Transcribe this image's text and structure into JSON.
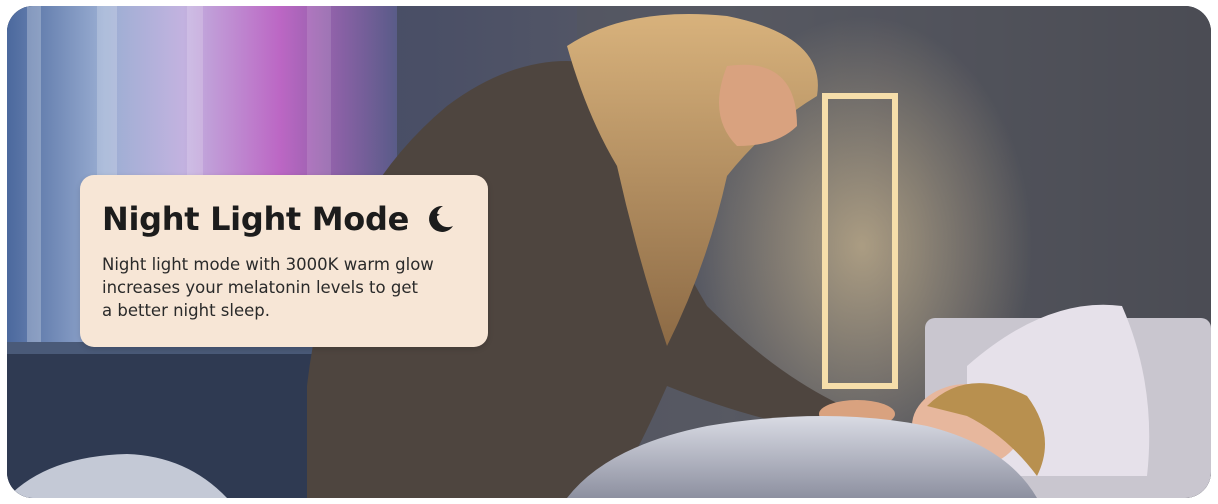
{
  "card": {
    "title": "Night Light Mode",
    "title_icon": "moon-stars-icon",
    "description_lines": [
      "Night light mode with 3000K warm glow",
      "increases your melatonin levels to get",
      "a better night sleep."
    ]
  },
  "colors": {
    "card_background": "#f7e6d6",
    "title_text": "#1c1c1c",
    "body_text": "#2a2a2a",
    "lamp_glow": "#f3d7a0"
  }
}
